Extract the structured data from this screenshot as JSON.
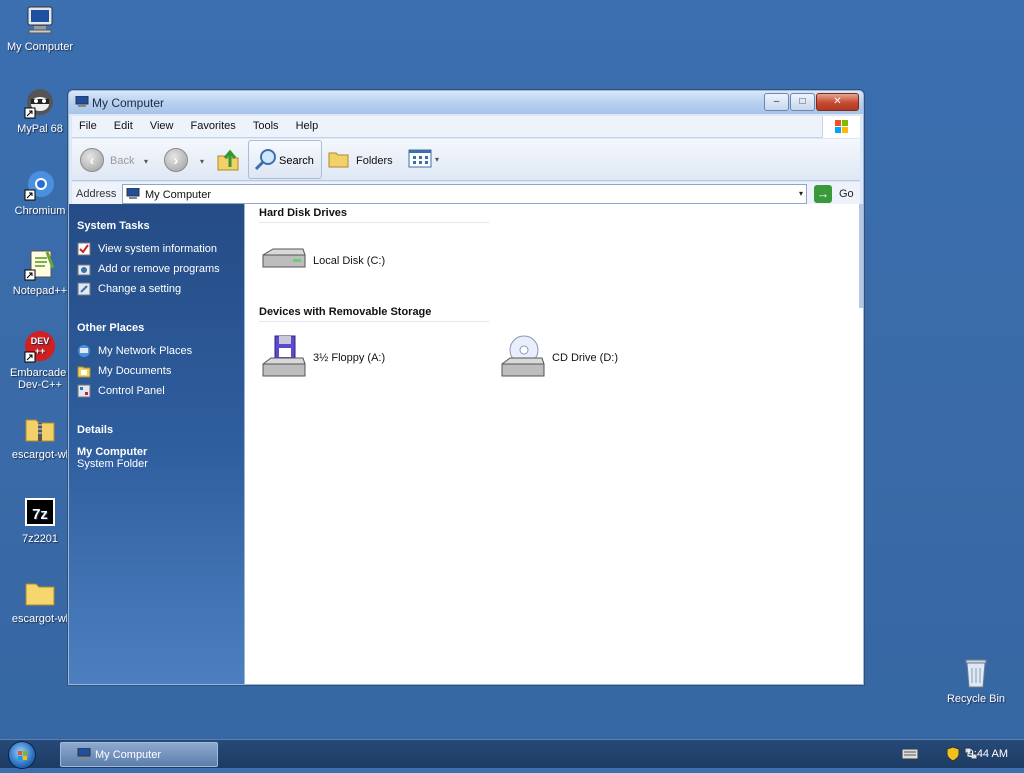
{
  "desktop": {
    "icons": [
      {
        "label": "My Computer",
        "icon": "my-computer-icon"
      },
      {
        "label": "MyPal 68",
        "icon": "mypal-icon"
      },
      {
        "label": "Chromium",
        "icon": "chromium-icon"
      },
      {
        "label": "Notepad++",
        "icon": "notepadpp-icon"
      },
      {
        "label_line1": "Embarcader",
        "label_line2": "Dev-C++",
        "icon": "devcpp-icon"
      },
      {
        "label": "escargot-wl",
        "icon": "zip-folder-icon"
      },
      {
        "label": "7z2201",
        "icon": "7zip-icon"
      },
      {
        "label": "escargot-wl",
        "icon": "folder-icon"
      },
      {
        "label": "Recycle Bin",
        "icon": "recycle-bin-icon"
      }
    ],
    "devcpp_badge": "DEV\n++"
  },
  "window": {
    "title": "My Computer",
    "controls": {
      "minimize": "–",
      "maximize": "□",
      "close": "✕"
    },
    "menu": [
      "File",
      "Edit",
      "View",
      "Favorites",
      "Tools",
      "Help"
    ],
    "toolbar": {
      "back": "Back",
      "back_glyph": "‹",
      "forward_glyph": "›",
      "search": "Search",
      "folders": "Folders",
      "dropdown": "▾"
    },
    "address": {
      "label": "Address",
      "value": "My Computer",
      "go": "Go",
      "go_glyph": "→",
      "dropdown": "▾"
    },
    "tasks": {
      "system_tasks_title": "System Tasks",
      "system_tasks": [
        "View system information",
        "Add or remove programs",
        "Change a setting"
      ],
      "other_places_title": "Other Places",
      "other_places": [
        "My Network Places",
        "My Documents",
        "Control Panel"
      ],
      "details_title": "Details",
      "details_name": "My Computer",
      "details_type": "System Folder"
    },
    "content": {
      "hard_disk_title": "Hard Disk Drives",
      "local_disk": "Local Disk (C:)",
      "removable_title": "Devices with Removable Storage",
      "floppy": "3½ Floppy (A:)",
      "cd_drive": "CD Drive (D:)"
    }
  },
  "taskbar": {
    "active_task": "My Computer",
    "clock": "9:44 AM"
  },
  "colors": {
    "desktop": "#3a6aa7",
    "task_pane": "#2f5e9e",
    "title_bar": "#b8d0ef"
  }
}
